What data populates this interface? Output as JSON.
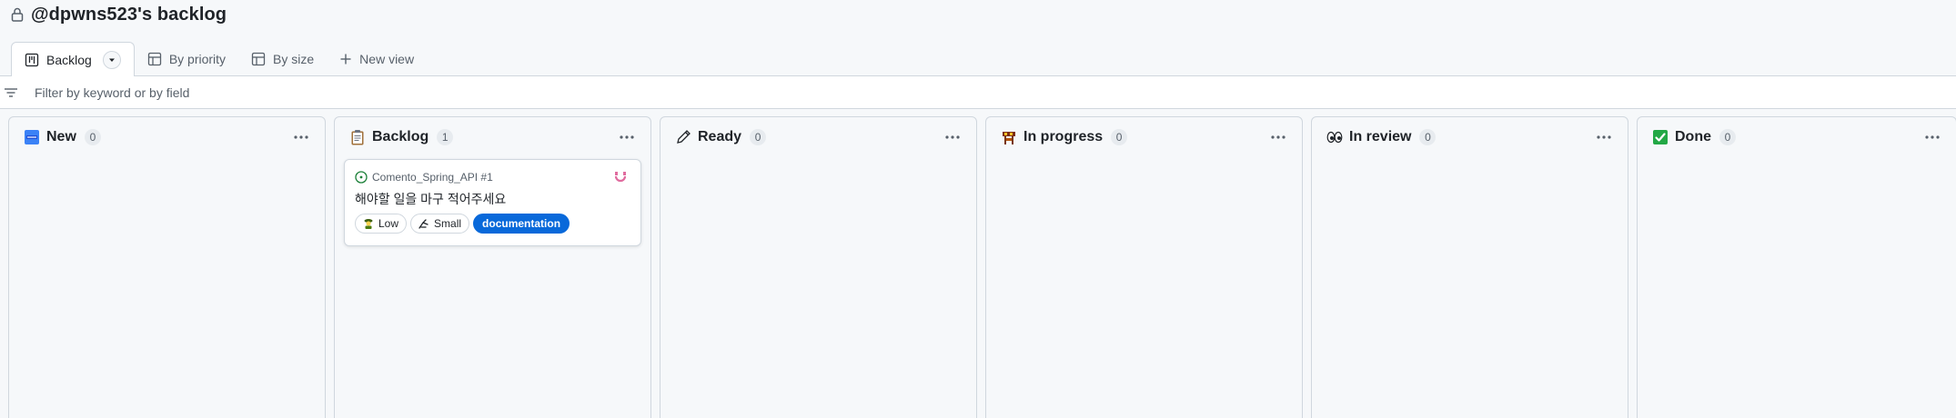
{
  "header": {
    "title": "@dpwns523's backlog"
  },
  "tabs": [
    {
      "label": "Backlog",
      "icon": "board-icon",
      "active": true
    },
    {
      "label": "By priority",
      "icon": "table-icon",
      "active": false
    },
    {
      "label": "By size",
      "icon": "table-icon",
      "active": false
    },
    {
      "label": "New view",
      "icon": "plus-icon",
      "active": false
    }
  ],
  "filter": {
    "placeholder": "Filter by keyword or by field",
    "value": ""
  },
  "columns": [
    {
      "name": "New",
      "count": "0",
      "icon": "new-emoji-icon"
    },
    {
      "name": "Backlog",
      "count": "1",
      "icon": "clipboard-emoji-icon"
    },
    {
      "name": "Ready",
      "count": "0",
      "icon": "pencil-emoji-icon"
    },
    {
      "name": "In progress",
      "count": "0",
      "icon": "construction-emoji-icon"
    },
    {
      "name": "In review",
      "count": "0",
      "icon": "eyes-emoji-icon"
    },
    {
      "name": "Done",
      "count": "0",
      "icon": "check-emoji-icon"
    }
  ],
  "card": {
    "repo": "Comento_Spring_API #1",
    "title": "해야할 일을 마구 적어주세요",
    "labels": [
      {
        "text": "Low",
        "icon": "pawn-emoji-icon"
      },
      {
        "text": "Small",
        "icon": "pinch-emoji-icon"
      },
      {
        "text": "documentation",
        "color": "#0969da"
      }
    ]
  },
  "colors": {
    "accent": "#0969da",
    "open_issue": "#1a7f37",
    "border": "#d0d7de"
  }
}
